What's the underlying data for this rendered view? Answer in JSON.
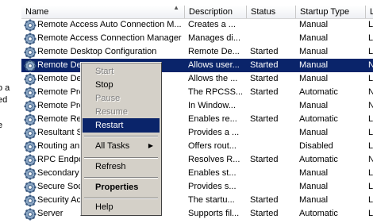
{
  "left_pane": {
    "fragments": [
      "t",
      "o a",
      "ed",
      "e"
    ]
  },
  "columns": {
    "name": "Name",
    "description": "Description",
    "status": "Status",
    "startup_type": "Startup Type",
    "log_on_as": "L"
  },
  "services": [
    {
      "name": "Remote Access Auto Connection M...",
      "description": "Creates a ...",
      "status": "",
      "startup": "Manual",
      "logon": "L"
    },
    {
      "name": "Remote Access Connection Manager",
      "description": "Manages di...",
      "status": "",
      "startup": "Manual",
      "logon": "L"
    },
    {
      "name": "Remote Desktop Configuration",
      "description": "Remote De...",
      "status": "Started",
      "startup": "Manual",
      "logon": "L"
    },
    {
      "name": "Remote De",
      "description": "Allows user...",
      "status": "Started",
      "startup": "Manual",
      "logon": "N",
      "selected": true
    },
    {
      "name": "Remote De                    od...",
      "description": "Allows the ...",
      "status": "Started",
      "startup": "Manual",
      "logon": "L"
    },
    {
      "name": "Remote Pro",
      "description": "The RPCSS...",
      "status": "Started",
      "startup": "Automatic",
      "logon": "N"
    },
    {
      "name": "Remote Pro                     cator",
      "description": "In Window...",
      "status": "",
      "startup": "Manual",
      "logon": "N"
    },
    {
      "name": "Remote Re",
      "description": "Enables re...",
      "status": "Started",
      "startup": "Automatic",
      "logon": "L"
    },
    {
      "name": "Resultant S",
      "description": "Provides a ...",
      "status": "",
      "startup": "Manual",
      "logon": "L"
    },
    {
      "name": "Routing an",
      "description": "Offers rout...",
      "status": "",
      "startup": "Disabled",
      "logon": "L"
    },
    {
      "name": "RPC Endpo",
      "description": "Resolves R...",
      "status": "Started",
      "startup": "Automatic",
      "logon": "N"
    },
    {
      "name": "Secondary",
      "description": "Enables st...",
      "status": "",
      "startup": "Manual",
      "logon": "L"
    },
    {
      "name": "Secure Soc                    l S...",
      "description": "Provides s...",
      "status": "",
      "startup": "Manual",
      "logon": "L"
    },
    {
      "name": "Security Ac",
      "description": "The startu...",
      "status": "Started",
      "startup": "Manual",
      "logon": "L"
    },
    {
      "name": "Server",
      "description": "Supports fil...",
      "status": "Started",
      "startup": "Automatic",
      "logon": "L"
    }
  ],
  "context_menu": {
    "start": "Start",
    "stop": "Stop",
    "pause": "Pause",
    "resume": "Resume",
    "restart": "Restart",
    "all_tasks": "All Tasks",
    "refresh": "Refresh",
    "properties": "Properties",
    "help": "Help"
  },
  "icons": {
    "service": "gear-icon",
    "submenu": "triangle-right-icon",
    "sort": "sort-up-icon"
  },
  "colors": {
    "selection": "#0a246a",
    "menu_bg": "#d4d0c8"
  }
}
